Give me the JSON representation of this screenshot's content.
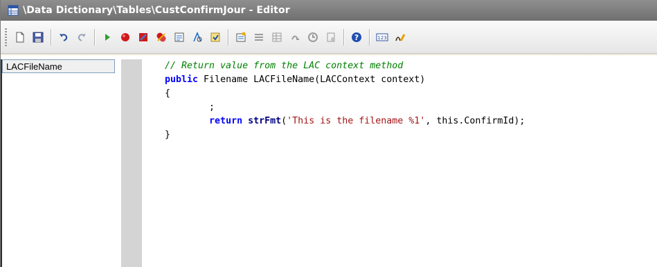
{
  "window": {
    "title": "\\Data Dictionary\\Tables\\CustConfirmJour - Editor"
  },
  "toolbar": {
    "buttons": [
      {
        "name": "new-icon"
      },
      {
        "name": "save-icon"
      },
      {
        "name": "undo-icon"
      },
      {
        "name": "redo-icon"
      },
      {
        "name": "run-icon"
      },
      {
        "name": "breakpoint-icon"
      },
      {
        "name": "toggle-breakpoint-icon"
      },
      {
        "name": "clear-breakpoints-icon"
      },
      {
        "name": "compile-icon"
      },
      {
        "name": "lookup-icon"
      },
      {
        "name": "script-icon"
      },
      {
        "name": "properties-icon"
      },
      {
        "name": "list-members-icon"
      },
      {
        "name": "list-tables-icon"
      },
      {
        "name": "list-types-icon"
      },
      {
        "name": "go-to-definition-icon"
      },
      {
        "name": "enum-icon"
      },
      {
        "name": "help-icon"
      },
      {
        "name": "label-icon"
      },
      {
        "name": "edit-label-icon"
      }
    ],
    "label_text": "123"
  },
  "methods": {
    "items": [
      "LACFileName"
    ]
  },
  "code": {
    "line1_comment": "// Return value from the LAC context method",
    "line2_kw": "public",
    "line2_rest": " Filename LACFileName(LACContext context)",
    "line3": "{",
    "line4": "        ;",
    "line5_indent": "        ",
    "line5_kw": "return",
    "line5_space": " ",
    "line5_fn": "strFmt",
    "line5_open": "(",
    "line5_str": "'This is the filename %1'",
    "line5_rest": ", this.ConfirmId);",
    "line6": "}"
  }
}
